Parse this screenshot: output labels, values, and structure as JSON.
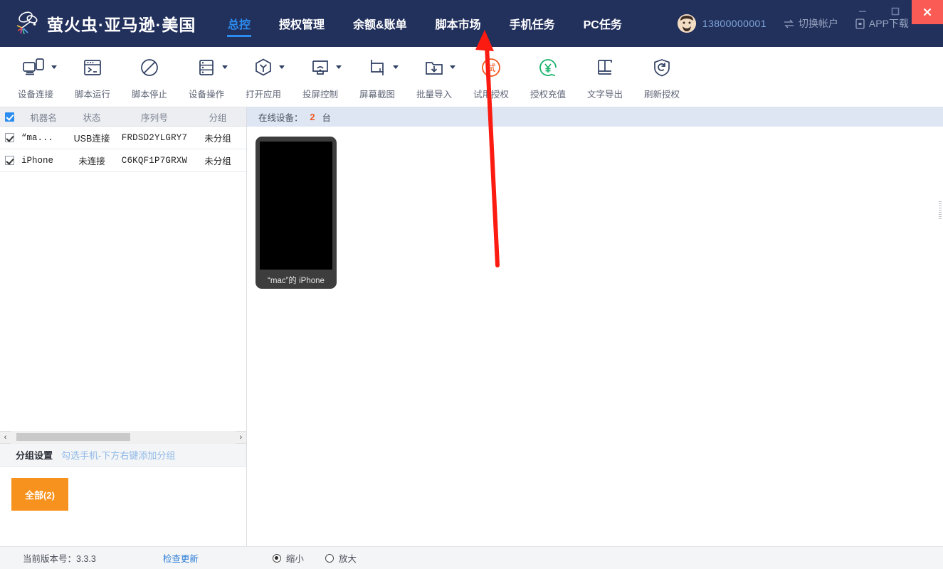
{
  "window": {
    "brand_title": "萤火虫·亚马逊·美国",
    "logo_icon": "firefly-icon",
    "minimize_label": "—",
    "maximize_label": "□",
    "close_label": "✕",
    "accent_blue": "#2b8cf0",
    "titlebar_bg": "#22305c",
    "orange": "#f7921e"
  },
  "nav": {
    "items": [
      {
        "label": "总控",
        "active": true
      },
      {
        "label": "授权管理",
        "active": false
      },
      {
        "label": "余额&账单",
        "active": false
      },
      {
        "label": "脚本市场",
        "active": false
      },
      {
        "label": "手机任务",
        "active": false
      },
      {
        "label": "PC任务",
        "active": false
      }
    ]
  },
  "account": {
    "avatar_icon": "user-avatar-icon",
    "phone": "13800000001",
    "switch_label": "切换帐户",
    "switch_icon": "swap-icon",
    "app_download_label": "APP下载",
    "app_download_icon": "phone-download-icon"
  },
  "toolbar": {
    "buttons": [
      {
        "label": "设备连接",
        "icon": "device-connect-icon",
        "caret": true,
        "color": "#2f3f62"
      },
      {
        "label": "脚本运行",
        "icon": "script-run-icon",
        "caret": false,
        "color": "#2f3f62"
      },
      {
        "label": "脚本停止",
        "icon": "script-stop-icon",
        "caret": false,
        "color": "#2f3f62"
      },
      {
        "label": "设备操作",
        "icon": "device-ops-icon",
        "caret": true,
        "color": "#2f3f62"
      },
      {
        "label": "打开应用",
        "icon": "open-app-icon",
        "caret": true,
        "color": "#2f3f62"
      },
      {
        "label": "投屏控制",
        "icon": "screen-cast-icon",
        "caret": true,
        "color": "#2f3f62"
      },
      {
        "label": "屏幕截图",
        "icon": "screenshot-icon",
        "caret": true,
        "color": "#2f3f62"
      },
      {
        "label": "批量导入",
        "icon": "batch-import-icon",
        "caret": true,
        "color": "#2f3f62"
      },
      {
        "label": "试用授权",
        "icon": "trial-license-icon",
        "caret": false,
        "color": "#f0561d"
      },
      {
        "label": "授权充值",
        "icon": "recharge-icon",
        "caret": false,
        "color": "#19b36b"
      },
      {
        "label": "文字导出",
        "icon": "text-export-icon",
        "caret": false,
        "color": "#2f3f62"
      },
      {
        "label": "刷新授权",
        "icon": "refresh-license-icon",
        "caret": false,
        "color": "#2f3f62"
      }
    ]
  },
  "device_table": {
    "header_checkbox_checked": true,
    "columns": [
      "机器名",
      "状态",
      "序列号",
      "分组"
    ],
    "rows": [
      {
        "checked": true,
        "name": "“ma...",
        "status": "USB连接",
        "status_color": "#1faa4c",
        "serial": "FRDSD2YLGRY7",
        "group": "未分组"
      },
      {
        "checked": true,
        "name": "iPhone",
        "status": "未连接",
        "status_color": "#f04b2a",
        "serial": "C6KQF1P7GRXW",
        "group": "未分组"
      }
    ]
  },
  "scrollbar": {
    "left_arrow": "‹",
    "right_arrow": "›"
  },
  "group_panel": {
    "title": "分组设置",
    "hint": "勾选手机-下方右键添加分组",
    "chips": [
      {
        "label": "全部(2)",
        "color": "#f7921e"
      }
    ]
  },
  "online_bar": {
    "label": "在线设备：",
    "count": "2",
    "unit": "台"
  },
  "devices": [
    {
      "label": "“mac”的 iPhone",
      "screen_state": "black"
    }
  ],
  "status_bar": {
    "version_label": "当前版本号：3.3.3",
    "check_update_label": "检查更新",
    "radios": [
      {
        "label": "缩小",
        "selected": true
      },
      {
        "label": "放大",
        "selected": false
      }
    ]
  },
  "annotation": {
    "arrow_color": "#fb1b10",
    "arrow_target": "手机任务"
  }
}
